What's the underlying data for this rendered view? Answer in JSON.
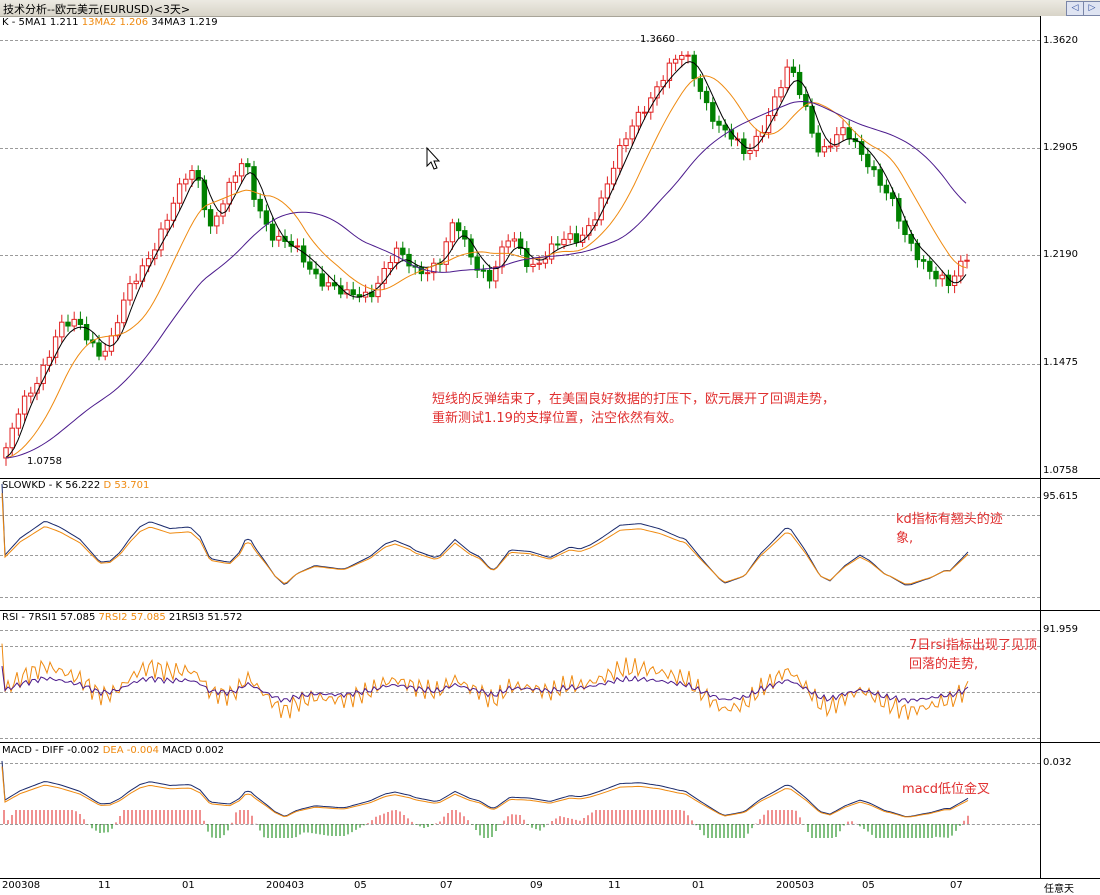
{
  "window": {
    "title": "技术分析--欧元美元(EURUSD)<3天>",
    "btn_prev": "◁",
    "btn_next": "▷"
  },
  "panels": {
    "price": {
      "label_prefix": "K - ",
      "ma1": "5MA1  1.211",
      "ma2": "13MA2  1.206",
      "ma3": "34MA3  1.219",
      "high_label": "1.3660",
      "low_label": "1.0758",
      "axis": [
        "1.3620",
        "1.2905",
        "1.2190",
        "1.1475",
        "1.0758"
      ],
      "annotation_line1": "短线的反弹结束了，在美国良好数据的打压下，欧元展开了回调走势，",
      "annotation_line2": "重新测试1.19的支撑位置，沽空依然有效。"
    },
    "kd": {
      "label_prefix": "SLOWKD - ",
      "k": "K  56.222",
      "d": "D  53.701",
      "axis": [
        "95.615"
      ],
      "annotation_line1": "kd指标有翘头的迹",
      "annotation_line2": "象,"
    },
    "rsi": {
      "label_prefix": "RSI - ",
      "rsi1": "7RSI1  57.085",
      "rsi2": "7RSI2  57.085",
      "rsi3": "21RSI3  51.572",
      "axis": [
        "91.959"
      ],
      "annotation_line1": "7日rsi指标出现了见顶",
      "annotation_line2": "回落的走势,"
    },
    "macd": {
      "label_prefix": "MACD - ",
      "diff": "DIFF  -0.002",
      "dea": "DEA  -0.004",
      "macd": "MACD  0.002",
      "axis": [
        "0.032"
      ],
      "annotation": "macd低位金叉"
    }
  },
  "x_axis": [
    "200308",
    "11",
    "01",
    "200403",
    "05",
    "07",
    "09",
    "11",
    "01",
    "200503",
    "05",
    "07"
  ],
  "period_button": "任意天",
  "colors": {
    "up": "#e02020",
    "down": "#008000",
    "ma1": "#000000",
    "ma2": "#ef8a10",
    "ma3": "#4b1a8c",
    "annotation": "#e03030"
  }
}
